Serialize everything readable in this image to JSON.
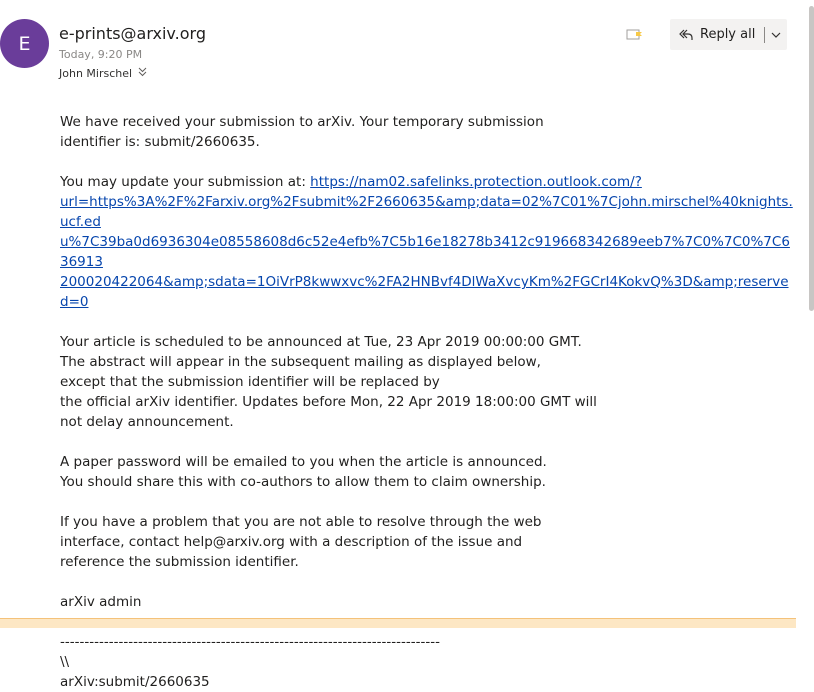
{
  "email": {
    "avatar_letter": "E",
    "avatar_color": "#6a3d9a",
    "sender": "e-prints@arxiv.org",
    "time": "Today, 9:20 PM",
    "recipient": "John Mirschel",
    "recipient_toggle_icon": "chevron-double-down-icon"
  },
  "toolbar": {
    "flag_icon": "flag-icon",
    "reply_all_label": "Reply all",
    "reply_icon": "reply-all-icon",
    "dropdown_icon": "chevron-down-icon"
  },
  "body": {
    "p1_line1": "We have received your submission to arXiv. Your temporary submission",
    "p1_line2": "identifier is: submit/2660635.",
    "p2_prefix": "You may update your submission at: ",
    "p2_link_l1": "https://nam02.safelinks.protection.outlook.com/?",
    "p2_link_l2": "url=https%3A%2F%2Farxiv.org%2Fsubmit%2F2660635&amp;data=02%7C01%7Cjohn.mirschel%40knights.ucf.ed",
    "p2_link_l3": "u%7C39ba0d6936304e08558608d6c52e4efb%7C5b16e18278b3412c919668342689eeb7%7C0%7C0%7C636913",
    "p2_link_l4": "200020422064&amp;sdata=1OiVrP8kwwxvc%2FA2HNBvf4DlWaXvcyKm%2FGCrI4KokvQ%3D&amp;reserved=0",
    "p3_l1": "Your article is scheduled to be announced at Tue, 23 Apr 2019 00:00:00 GMT.",
    "p3_l2": "The abstract will appear in the subsequent mailing as displayed below,",
    "p3_l3": "except that the submission identifier will be replaced by",
    "p3_l4": "the official arXiv identifier. Updates before Mon, 22 Apr 2019 18:00:00 GMT will",
    "p3_l5": "not delay announcement.",
    "p4_l1": "A paper password will be emailed to you when the article is announced.",
    "p4_l2": "You should share this with co-authors to allow them to claim ownership.",
    "p5_l1": "If you have a problem that you are not able to resolve through the web",
    "p5_l2": "interface, contact help@arxiv.org with a description of the issue and",
    "p5_l3": "reference the submission identifier.",
    "signature": "arXiv admin",
    "divider": "------------------------------------------------------------------------------",
    "backslashes": "\\\\",
    "submit_id": "arXiv:submit/2660635"
  }
}
